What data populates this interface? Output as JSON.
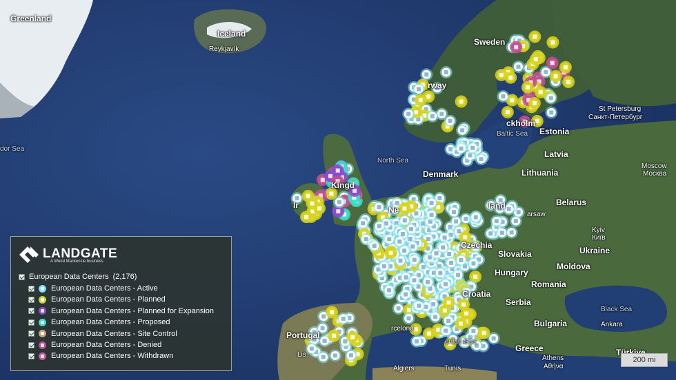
{
  "labels": {
    "countries": [
      {
        "id": "greenland",
        "text": "Greenland"
      },
      {
        "id": "iceland",
        "text": "Iceland"
      },
      {
        "id": "sweden",
        "text": "Sweden"
      },
      {
        "id": "norway",
        "text": "Norway"
      },
      {
        "id": "estonia",
        "text": "Estonia"
      },
      {
        "id": "latvia",
        "text": "Latvia"
      },
      {
        "id": "lithuania",
        "text": "Lithuania"
      },
      {
        "id": "denmark",
        "text": "Denmark"
      },
      {
        "id": "belarus",
        "text": "Belarus"
      },
      {
        "id": "ukraine",
        "text": "Ukraine"
      },
      {
        "id": "moldova",
        "text": "Moldova"
      },
      {
        "id": "romania",
        "text": "Romania"
      },
      {
        "id": "slovakia",
        "text": "Slovakia"
      },
      {
        "id": "czechia",
        "text": "Czechia"
      },
      {
        "id": "hungary",
        "text": "Hungary"
      },
      {
        "id": "croatia",
        "text": "Croatia"
      },
      {
        "id": "serbia",
        "text": "Serbia"
      },
      {
        "id": "bulgaria",
        "text": "Bulgaria"
      },
      {
        "id": "greece",
        "text": "Greece"
      },
      {
        "id": "portugal",
        "text": "Portugal"
      },
      {
        "id": "turkey",
        "text": "Türkiye"
      },
      {
        "id": "kingdom",
        "text": "Kingd"
      },
      {
        "id": "ireland",
        "text": "Ir"
      },
      {
        "id": "poland",
        "text": "land"
      }
    ],
    "cities": [
      {
        "id": "reykjavik",
        "text": "Reykjavík"
      },
      {
        "id": "stockholm",
        "text": "ckholm"
      },
      {
        "id": "st-petersburg",
        "text": "St Petersburg"
      },
      {
        "id": "st-petersburg-ru",
        "text": "Санкт-Петербург"
      },
      {
        "id": "moscow",
        "text": "Moscow"
      },
      {
        "id": "moscow-ru",
        "text": "Москва"
      },
      {
        "id": "kyiv",
        "text": "Kyiv"
      },
      {
        "id": "kyiv-ua",
        "text": "Київ"
      },
      {
        "id": "warsaw",
        "text": "arsaw"
      },
      {
        "id": "athens",
        "text": "Athens"
      },
      {
        "id": "athens-gr",
        "text": "Αθήνα"
      },
      {
        "id": "ankara",
        "text": "Ankara"
      },
      {
        "id": "algiers",
        "text": "Algiers"
      },
      {
        "id": "tunis",
        "text": "Tunis"
      },
      {
        "id": "barcelona",
        "text": "rcelona"
      },
      {
        "id": "lisbon",
        "text": "Lis"
      },
      {
        "id": "ne",
        "text": "Ne"
      },
      {
        "id": "norway-partial",
        "text": "rway"
      }
    ],
    "water": [
      {
        "id": "north-sea",
        "text": "North Sea"
      },
      {
        "id": "baltic-sea",
        "text": "Baltic Sea"
      },
      {
        "id": "black-sea",
        "text": "Black Sea"
      },
      {
        "id": "labrador-sea",
        "text": "dor Sea"
      },
      {
        "id": "tyrrhenian-sea",
        "text": "enian Sea"
      }
    ]
  },
  "legend": {
    "brand": "LANDGATE",
    "tagline": "A Wood Mackenzie business",
    "root_label": "European Data Centers",
    "root_count": "(2,176)",
    "layers": [
      {
        "label": "European Data Centers - Active",
        "color": "#7ee3ee"
      },
      {
        "label": "European Data Centers - Planned",
        "color": "#c8d62e"
      },
      {
        "label": "European Data Centers - Planned for Expansion",
        "color": "#8a4ccf"
      },
      {
        "label": "European Data Centers - Proposed",
        "color": "#3ce0c9"
      },
      {
        "label": "European Data Centers - Site Control",
        "color": "#c7a37a"
      },
      {
        "label": "European Data Centers - Denied",
        "color": "#c1508f"
      },
      {
        "label": "European Data Centers - Withdrawn",
        "color": "#c55a9d"
      }
    ]
  },
  "scale": {
    "text": "200 mi"
  },
  "colors": {
    "ocean": "#1f3a6e",
    "land": "#3d5a3a",
    "ice": "#e9eef2",
    "active": "#ffffff",
    "active_ring": "#7ee3ee",
    "planned": "#d8d31e",
    "expansion": "#8a4ccf",
    "proposed": "#3ce0c9",
    "denied": "#c1508f"
  }
}
